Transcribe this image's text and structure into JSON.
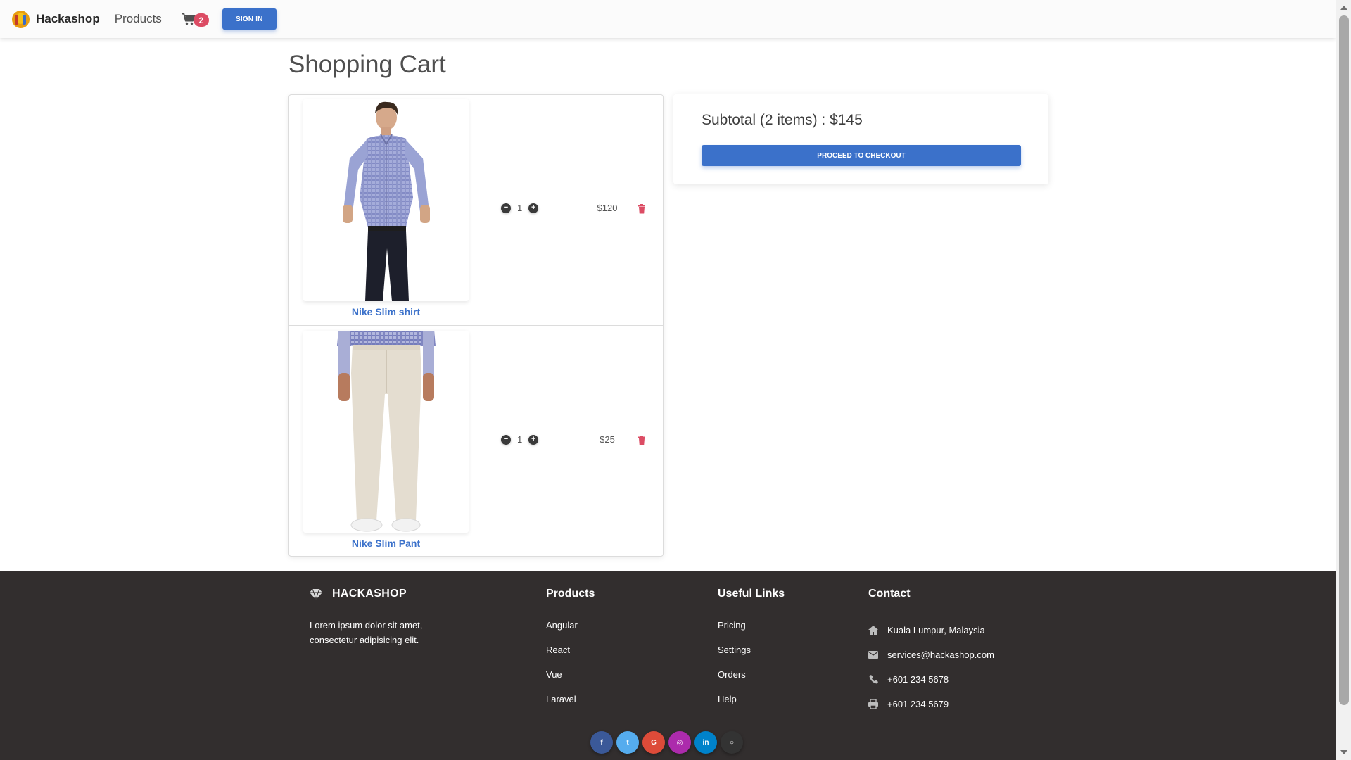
{
  "navbar": {
    "brand_name": "Hackashop",
    "products_link": "Products",
    "cart_count": "2",
    "signin_label": "SIGN IN"
  },
  "page_title": "Shopping Cart",
  "cart": {
    "items": [
      {
        "name": "Nike Slim shirt",
        "quantity": "1",
        "price": "$120",
        "image": "man-in-checked-shirt-photo"
      },
      {
        "name": "Nike Slim Pant",
        "quantity": "1",
        "price": "$25",
        "image": "beige-pants-photo"
      }
    ]
  },
  "summary": {
    "subtotal_text": "Subtotal (2 items) : $145",
    "checkout_label": "PROCEED TO CHECKOUT"
  },
  "footer": {
    "brand": "HACKASHOP",
    "description": "Lorem ipsum dolor sit amet, consectetur adipisicing elit.",
    "products_heading": "Products",
    "products": [
      "Angular",
      "React",
      "Vue",
      "Laravel"
    ],
    "useful_heading": "Useful Links",
    "useful_links": [
      "Pricing",
      "Settings",
      "Orders",
      "Help"
    ],
    "contact_heading": "Contact",
    "contact": [
      {
        "icon": "home-icon",
        "text": "Kuala Lumpur, Malaysia"
      },
      {
        "icon": "envelope-icon",
        "text": "services@hackashop.com"
      },
      {
        "icon": "phone-icon",
        "text": "+601 234 5678"
      },
      {
        "icon": "print-icon",
        "text": "+601 234 5679"
      }
    ],
    "socials": [
      {
        "name": "facebook",
        "glyph": "f",
        "color": "#3b5998"
      },
      {
        "name": "twitter",
        "glyph": "t",
        "color": "#55acee"
      },
      {
        "name": "google",
        "glyph": "G",
        "color": "#dd4b39"
      },
      {
        "name": "instagram",
        "glyph": "◎",
        "color": "#ac2bac"
      },
      {
        "name": "linkedin",
        "glyph": "in",
        "color": "#0082ca"
      },
      {
        "name": "github",
        "glyph": "○",
        "color": "#333333"
      }
    ]
  },
  "colors": {
    "primary": "#3b71ca",
    "danger": "#dc4c64",
    "footer_bg": "#322e2e"
  }
}
